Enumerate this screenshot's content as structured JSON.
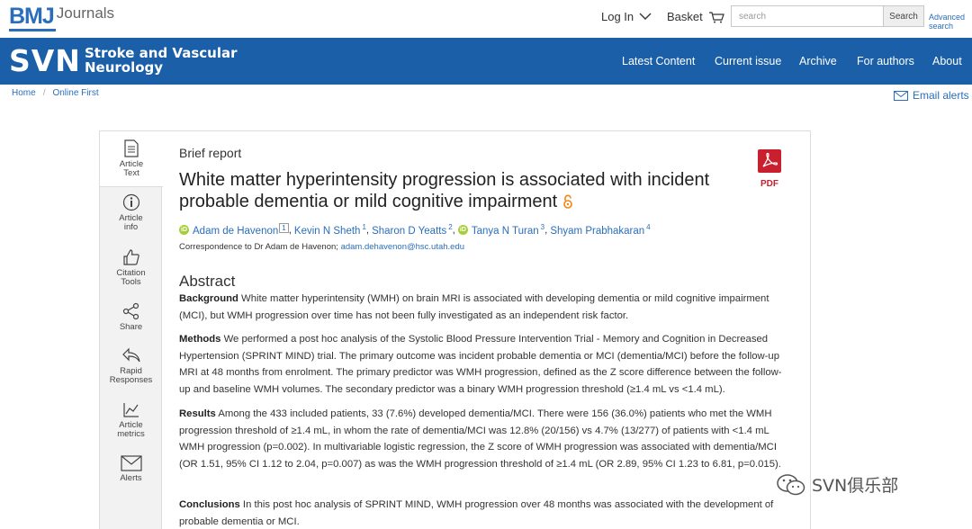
{
  "topbar": {
    "brand_mark": "BMJ",
    "brand_suffix": "Journals",
    "login_label": "Log In",
    "basket_label": "Basket",
    "search_placeholder": "search",
    "search_button": "Search",
    "advanced_search_line1": "Advanced",
    "advanced_search_line2": "search"
  },
  "journal": {
    "abbr": "SVN",
    "name_line1": "Stroke and Vascular",
    "name_line2": "Neurology",
    "nav": [
      "Latest Content",
      "Current issue",
      "Archive",
      "For authors",
      "About"
    ],
    "header_color": "#1a5fa8"
  },
  "breadcrumb": [
    "Home",
    "Online First"
  ],
  "email_alerts": "Email alerts",
  "sidetools": [
    {
      "icon": "document-icon",
      "line1": "Article",
      "line2": "Text"
    },
    {
      "icon": "info-icon",
      "line1": "Article",
      "line2": "info"
    },
    {
      "icon": "thumbs-up-icon",
      "line1": "Citation",
      "line2": "Tools"
    },
    {
      "icon": "share-icon",
      "line1": "Share",
      "line2": ""
    },
    {
      "icon": "reply-icon",
      "line1": "Rapid",
      "line2": "Responses"
    },
    {
      "icon": "chart-icon",
      "line1": "Article",
      "line2": "metrics"
    },
    {
      "icon": "envelope-icon",
      "line1": "Alerts",
      "line2": ""
    }
  ],
  "article": {
    "type": "Brief report",
    "title": "White matter hyperintensity progression is associated with incident probable dementia or mild cognitive impairment",
    "pdf_label": "PDF",
    "authors": [
      {
        "name": "Adam de Havenon",
        "aff": "1",
        "orcid": true,
        "boxed": true
      },
      {
        "name": "Kevin N Sheth",
        "aff": "1",
        "orcid": false,
        "boxed": false
      },
      {
        "name": "Sharon D Yeatts",
        "aff": "2",
        "orcid": false,
        "boxed": false
      },
      {
        "name": "Tanya N Turan",
        "aff": "3",
        "orcid": true,
        "boxed": false
      },
      {
        "name": "Shyam Prabhakaran",
        "aff": "4",
        "orcid": false,
        "boxed": false
      }
    ],
    "orcid_glyph": "iD",
    "correspondence_prefix": "Correspondence to Dr Adam de Havenon; ",
    "correspondence_email": "adam.dehavenon@hsc.utah.edu",
    "abstract_heading": "Abstract",
    "abstract": [
      {
        "label": "Background",
        "text": " White matter hyperintensity (WMH) on brain MRI is associated with developing dementia or mild cognitive impairment (MCI), but WMH progression over time has not been fully investigated as an independent risk factor."
      },
      {
        "label": "Methods",
        "text": " We performed a post hoc analysis of the Systolic Blood Pressure Intervention Trial - Memory and Cognition in Decreased Hypertension (SPRINT MIND) trial. The primary outcome was incident probable dementia or MCI (dementia/MCI) before the follow-up MRI at 48 months from enrolment. The primary predictor was WMH progression, defined as the Z score difference between the follow-up and baseline WMH volumes. The secondary predictor was a binary WMH progression threshold (≥1.4 mL vs <1.4 mL)."
      },
      {
        "label": "Results",
        "text": " Among the 433 included patients, 33 (7.6%) developed dementia/MCI. There were 156 (36.0%) patients who met the WMH progression threshold of ≥1.4 mL, in whom the rate of dementia/MCI was 12.8% (20/156) vs 4.7% (13/277) of patients with <1.4 mL WMH progression (p=0.002). In multivariable logistic regression, the Z score of WMH progression was associated with dementia/MCI (OR 1.51, 95% CI 1.12 to 2.04, p=0.007) as was the WMH progression threshold of ≥1.4 mL (OR 2.89, 95% CI 1.23 to 6.81, p=0.015)."
      },
      {
        "label": "Conclusions",
        "text": " In this post hoc analysis of SPRINT MIND, WMH progression over 48 months was associated with the development of probable dementia or MCI."
      }
    ]
  },
  "watermark": "SVN俱乐部",
  "colors": {
    "link": "#2a6ebb",
    "pdf": "#c8202f",
    "orcid": "#a6ce39"
  }
}
